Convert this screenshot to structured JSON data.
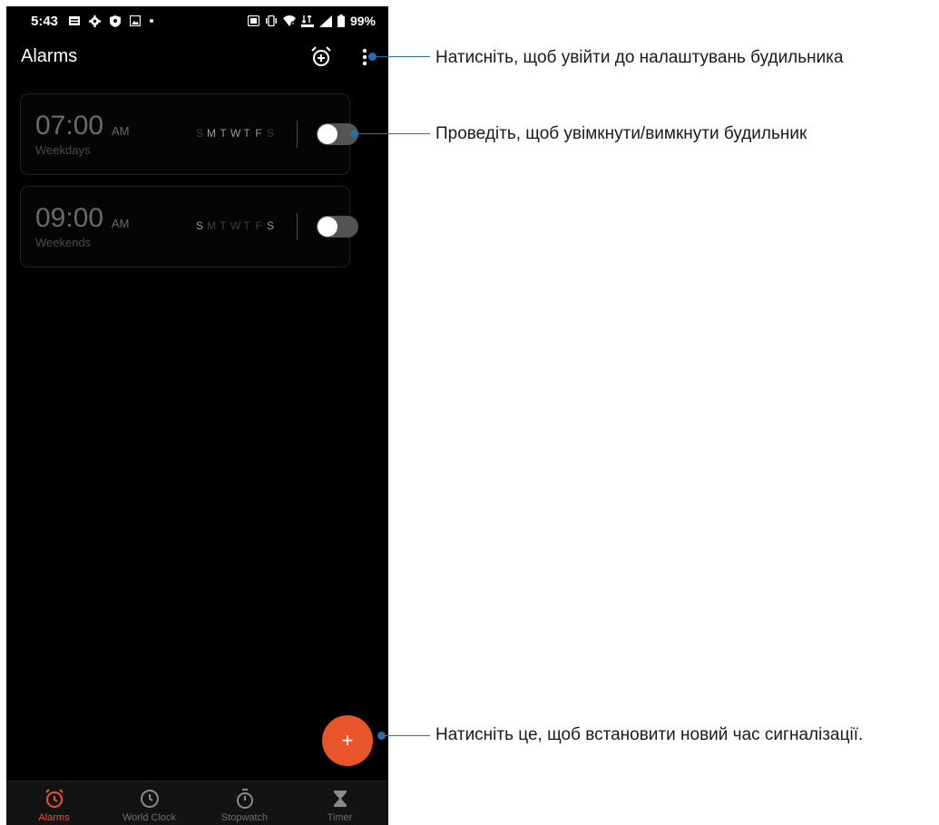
{
  "status_bar": {
    "time": "5:43",
    "battery": "99%",
    "icons": [
      "notification-icon",
      "settings-icon",
      "shield-icon",
      "gallery-icon",
      "dot-icon",
      "nfc-icon",
      "vibrate-icon",
      "wifi-icon",
      "data-icon",
      "signal-icon",
      "battery-icon"
    ]
  },
  "header": {
    "title": "Alarms",
    "icons": [
      "add-alarm-icon",
      "more-options-icon"
    ]
  },
  "alarms": [
    {
      "time": "07:00",
      "ampm": "AM",
      "label": "Weekdays",
      "days": [
        "S",
        "M",
        "T",
        "W",
        "T",
        "F",
        "S"
      ],
      "active_days": [
        false,
        true,
        true,
        true,
        true,
        true,
        false
      ],
      "enabled": false
    },
    {
      "time": "09:00",
      "ampm": "AM",
      "label": "Weekends",
      "days": [
        "S",
        "M",
        "T",
        "W",
        "T",
        "F",
        "S"
      ],
      "active_days": [
        true,
        false,
        false,
        false,
        false,
        false,
        true
      ],
      "enabled": false
    }
  ],
  "fab": {
    "label": "+",
    "color": "#e8552b"
  },
  "bottom_nav": [
    {
      "label": "Alarms",
      "icon": "alarm-clock-icon",
      "active": true
    },
    {
      "label": "World Clock",
      "icon": "clock-icon",
      "active": false
    },
    {
      "label": "Stopwatch",
      "icon": "stopwatch-icon",
      "active": false
    },
    {
      "label": "Timer",
      "icon": "hourglass-icon",
      "active": false
    }
  ],
  "callouts": {
    "settings": "Натисніть, щоб увійти до налаштувань будильника",
    "toggle": "Проведіть, щоб увімкнути/вимкнути будильник",
    "add": "Натисніть це, щоб встановити новий час сигналізації."
  },
  "colors": {
    "accent": "#e8552b",
    "callout": "#2a6fab",
    "background": "#000000"
  }
}
